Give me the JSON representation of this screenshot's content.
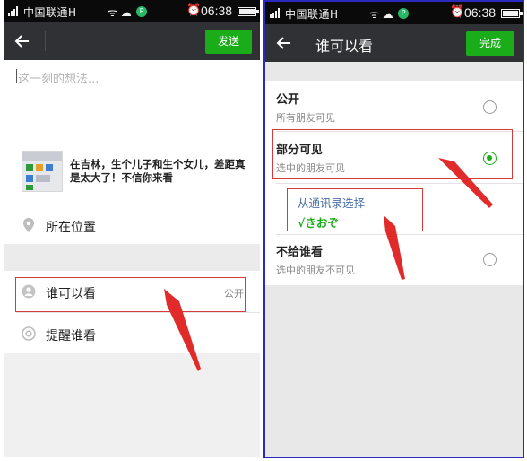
{
  "status_bar": {
    "carrier": "中国联通H",
    "extra_icons": "ᯤ ☁",
    "app_badge": "P",
    "time": "06:38"
  },
  "left_screen": {
    "send_label": "发送",
    "placeholder": "这一刻的想法...",
    "article_title": "在吉林，生个儿子和生个女儿，差距真是太大了！不信你来看",
    "location_label": "所在位置",
    "visibility_label": "谁可以看",
    "visibility_value": "公开",
    "remind_label": "提醒谁看"
  },
  "right_screen": {
    "title": "谁可以看",
    "done_label": "完成",
    "options": [
      {
        "title": "公开",
        "subtitle": "所有朋友可见",
        "selected": false
      },
      {
        "title": "部分可见",
        "subtitle": "选中的朋友可见",
        "selected": true
      },
      {
        "title": "不给谁看",
        "subtitle": "选中的朋友不可见",
        "selected": false
      }
    ],
    "contact_link": "从通讯录选择",
    "selected_contact": "√きおぞ"
  },
  "colors": {
    "nav_bar": "#2f3134",
    "wechat_green": "#1aad19",
    "highlight_red": "#d83a3a",
    "panel_border": "#2a2ac0",
    "link_blue": "#4a6fa8"
  },
  "icons": {
    "back": "arrow-left-icon",
    "location": "location-pin-icon",
    "visibility": "person-icon",
    "remind": "at-sign-icon",
    "radio_on": "radio-checked-icon",
    "radio_off": "radio-empty-icon"
  }
}
